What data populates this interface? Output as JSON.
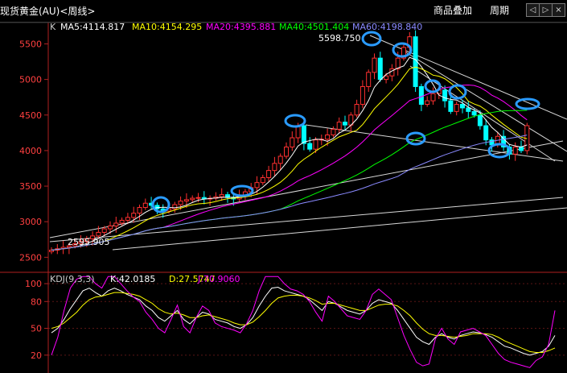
{
  "window": {
    "title": "现货黄金(AU)<周线>",
    "overlay_button": "商品叠加",
    "period_button": "周期",
    "nav_prev": "◁",
    "nav_next": "▷",
    "nav_close": "×"
  },
  "main_panel": {
    "code": "K",
    "ma": [
      {
        "label": "MA5:4114.817",
        "color": "#ffffff"
      },
      {
        "label": "MA10:4154.295",
        "color": "#ffff00"
      },
      {
        "label": "MA20:4395.881",
        "color": "#ff00ff"
      },
      {
        "label": "MA40:4501.404",
        "color": "#00ff00"
      },
      {
        "label": "MA60:4198.840",
        "color": "#8a8aff"
      }
    ],
    "max_label": "5598.750",
    "min_label": "2595.905",
    "y_ticks": [
      "5500",
      "5000",
      "4500",
      "4000",
      "3500",
      "3000",
      "2500"
    ]
  },
  "kdj_panel": {
    "title": "KDJ(9,3,3)",
    "k_label": "K:42.0185",
    "d_label": "D:27.5747",
    "j_label": "J:70.9060",
    "y_ticks": [
      "100",
      "80",
      "50",
      "20"
    ]
  },
  "colors": {
    "up": "#ff3030",
    "down": "#00ffff",
    "axis": "#b02020",
    "ma5": "#ffffff",
    "ma10": "#ffff00",
    "ma20": "#ff00ff",
    "ma40": "#00ff00",
    "ma60": "#8a8aff",
    "kdj_k": "#ffffff",
    "kdj_d": "#ffff00",
    "kdj_j": "#ff00ff",
    "circle": "#2a9bff"
  },
  "chart_data": {
    "type": "candlestick",
    "main_ylim": [
      2300,
      5800
    ],
    "kdj_ylim": [
      0,
      110
    ],
    "close": [
      2600,
      2620,
      2640,
      2660,
      2690,
      2720,
      2760,
      2800,
      2850,
      2900,
      2940,
      2980,
      3020,
      3060,
      3120,
      3200,
      3260,
      3230,
      3180,
      3150,
      3180,
      3240,
      3290,
      3310,
      3330,
      3340,
      3320,
      3330,
      3350,
      3380,
      3340,
      3320,
      3360,
      3420,
      3480,
      3550,
      3620,
      3720,
      3820,
      3920,
      4050,
      4180,
      4350,
      4100,
      4020,
      4150,
      4160,
      4220,
      4300,
      4400,
      4360,
      4500,
      4650,
      4900,
      5100,
      5300,
      5000,
      5050,
      5150,
      5300,
      5450,
      5600,
      4900,
      4650,
      4700,
      4800,
      4850,
      4700,
      4550,
      4650,
      4600,
      4550,
      4500,
      4350,
      4150,
      4080,
      4200,
      4050,
      3950,
      4050,
      4000,
      4350
    ],
    "k": [
      45,
      50,
      60,
      72,
      82,
      92,
      95,
      90,
      86,
      92,
      95,
      92,
      88,
      85,
      82,
      75,
      70,
      62,
      58,
      64,
      70,
      60,
      55,
      62,
      68,
      66,
      60,
      58,
      56,
      52,
      50,
      54,
      62,
      75,
      86,
      95,
      96,
      92,
      90,
      88,
      86,
      82,
      76,
      70,
      80,
      78,
      74,
      70,
      68,
      66,
      70,
      78,
      82,
      80,
      78,
      70,
      60,
      50,
      40,
      35,
      32,
      40,
      44,
      40,
      38,
      42,
      44,
      46,
      45,
      43,
      40,
      35,
      30,
      28,
      25,
      22,
      20,
      22,
      24,
      30,
      42
    ],
    "d": [
      50,
      52,
      56,
      62,
      68,
      76,
      82,
      85,
      86,
      88,
      90,
      90,
      89,
      88,
      86,
      82,
      78,
      72,
      68,
      66,
      67,
      65,
      62,
      62,
      64,
      65,
      63,
      61,
      59,
      56,
      54,
      54,
      57,
      63,
      70,
      78,
      84,
      86,
      87,
      87,
      86,
      84,
      81,
      77,
      78,
      78,
      76,
      74,
      72,
      70,
      70,
      73,
      76,
      77,
      77,
      75,
      70,
      64,
      56,
      49,
      44,
      42,
      42,
      41,
      40,
      41,
      42,
      44,
      44,
      44,
      43,
      40,
      36,
      33,
      30,
      27,
      24,
      23,
      23,
      25,
      28
    ],
    "j": [
      20,
      40,
      70,
      95,
      105,
      108,
      108,
      100,
      95,
      108,
      108,
      100,
      92,
      85,
      80,
      68,
      60,
      50,
      45,
      60,
      76,
      52,
      45,
      62,
      75,
      70,
      56,
      52,
      50,
      48,
      45,
      55,
      70,
      92,
      108,
      108,
      108,
      100,
      94,
      92,
      88,
      80,
      68,
      58,
      86,
      80,
      72,
      64,
      62,
      60,
      70,
      88,
      94,
      88,
      82,
      62,
      42,
      26,
      12,
      8,
      10,
      38,
      50,
      38,
      32,
      46,
      48,
      50,
      46,
      42,
      32,
      22,
      15,
      12,
      10,
      8,
      6,
      14,
      18,
      32,
      70
    ]
  }
}
